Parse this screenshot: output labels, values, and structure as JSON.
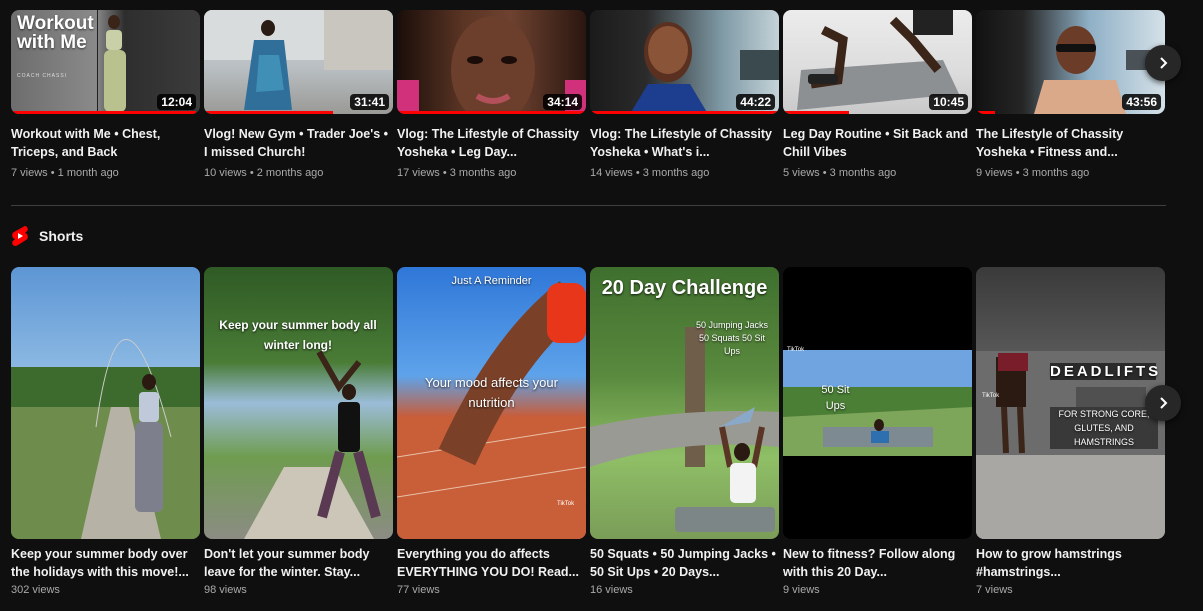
{
  "videos": [
    {
      "overlay_title": "Workout with Me",
      "overlay_sub": "COACH CHASSI",
      "duration": "12:04",
      "title": "Workout with Me • Chest, Triceps, and Back",
      "meta": "7 views • 1 month ago",
      "progress": 0.98
    },
    {
      "duration": "31:41",
      "title": "Vlog! New Gym • Trader Joe's • I missed Church!",
      "meta": "10 views • 2 months ago",
      "progress": 0.68
    },
    {
      "duration": "34:14",
      "title": "Vlog: The Lifestyle of Chassity Yosheka • Leg Day...",
      "meta": "17 views • 3 months ago",
      "progress": 1.0
    },
    {
      "duration": "44:22",
      "title": "Vlog: The Lifestyle of Chassity Yosheka • What's i...",
      "meta": "14 views • 3 months ago",
      "progress": 1.0
    },
    {
      "duration": "10:45",
      "title": "Leg Day Routine • Sit Back and Chill Vibes",
      "meta": "5 views • 3 months ago",
      "progress": 0.35
    },
    {
      "duration": "43:56",
      "title": "The Lifestyle of Chassity Yosheka • Fitness and...",
      "meta": "9 views • 3 months ago",
      "progress": 0.1
    }
  ],
  "shorts_header": {
    "label": "Shorts"
  },
  "shorts": [
    {
      "caption": "",
      "title": "Keep your summer body over the holidays with this move!...",
      "meta": "302 views"
    },
    {
      "caption": "Keep your summer body all winter long!",
      "title": "Don't let your summer body leave for the winter. Stay...",
      "meta": "98 views"
    },
    {
      "caption_top": "Just A Reminder",
      "caption": "Your mood affects your nutrition",
      "tiktok": "TikTok",
      "title": "Everything you do affects EVERYTHING YOU DO! Read...",
      "meta": "77 views"
    },
    {
      "caption_top": "20 Day Challenge",
      "caption": "50 Jumping Jacks 50 Squats 50 Sit Ups",
      "title": "50 Squats • 50 Jumping Jacks • 50 Sit Ups • 20 Days...",
      "meta": "16 views"
    },
    {
      "caption": "50 Sit Ups",
      "tiktok": "TikTok",
      "title": "New to fitness? Follow along with this 20 Day...",
      "meta": "9 views"
    },
    {
      "caption_top": "DEADLIFTS",
      "caption": "FOR STRONG CORE, GLUTES, AND HAMSTRINGS",
      "tiktok": "TikTok",
      "title": "How to grow hamstrings #hamstrings...",
      "meta": "7 views"
    }
  ],
  "colors": {
    "accent": "#ff0000",
    "background": "#0f0f0f",
    "meta_text": "#aaaaaa"
  }
}
